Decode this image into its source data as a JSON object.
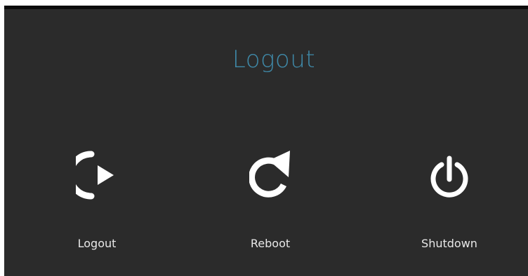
{
  "dialog": {
    "title": "Logout",
    "title_color": "#3f89a8",
    "background_color": "#2b2b2b"
  },
  "options": [
    {
      "label": "Logout",
      "icon": "logout-icon"
    },
    {
      "label": "Reboot",
      "icon": "reboot-icon"
    },
    {
      "label": "Shutdown",
      "icon": "power-icon"
    }
  ]
}
